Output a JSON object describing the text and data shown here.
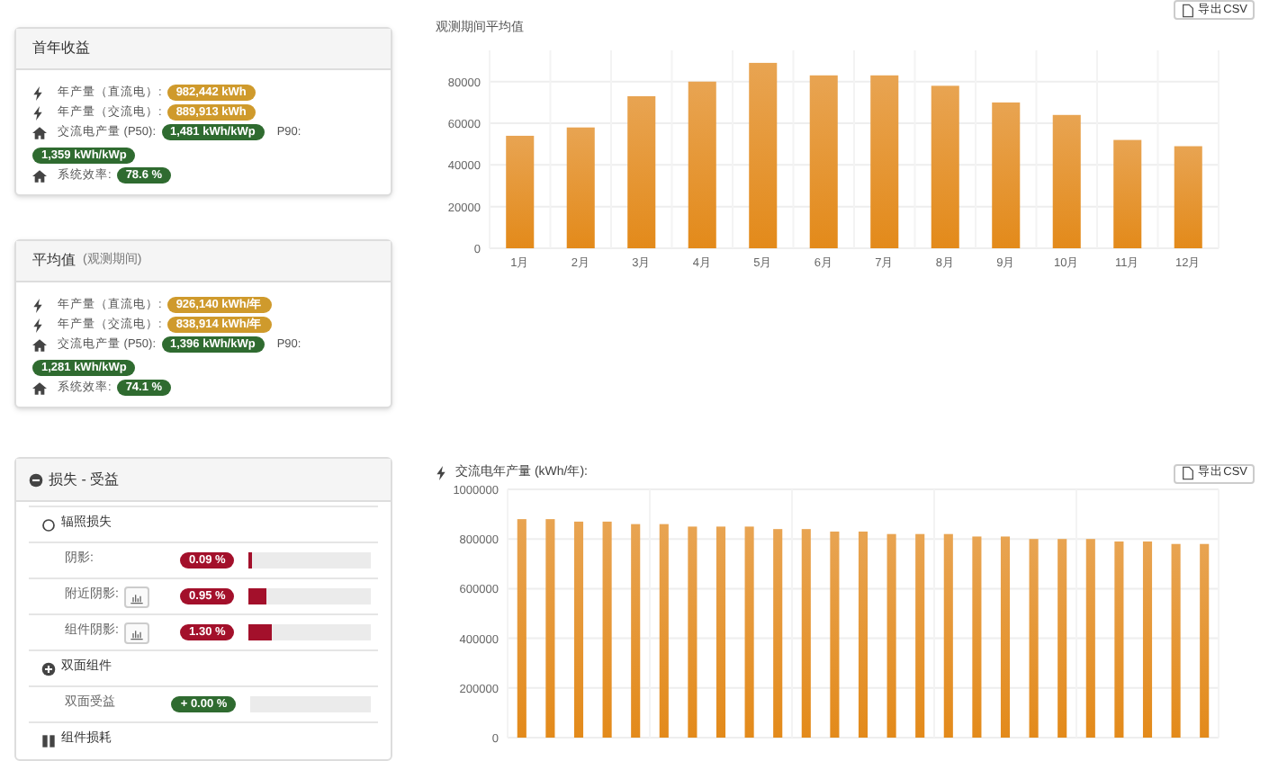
{
  "cards": [
    {
      "title": "首年收益",
      "items": [
        {
          "kind": "dc",
          "label": "年产量（直流电）:",
          "value": "982,442 kWh",
          "color": "#cf9a2c"
        },
        {
          "kind": "ac",
          "label": "年产量（交流电）:",
          "value": "889,913 kWh",
          "color": "#cf9a2c"
        },
        {
          "kind": "yield",
          "label": "交流电产量 (P50):",
          "value": "1,481 kWh/kWp",
          "color": "#2f6b30",
          "extra_label": "P90:",
          "extra_value": "1,359 kWh/kWp"
        },
        {
          "kind": "efficiency",
          "label": "系统效率:",
          "value": "78.6 %",
          "color": "#2f6b30"
        }
      ]
    },
    {
      "title": "平均值",
      "subtitle": "(观测期间)",
      "items": [
        {
          "kind": "dc",
          "label": "年产量（直流电）:",
          "value": "926,140 kWh/年",
          "color": "#cf9a2c"
        },
        {
          "kind": "ac",
          "label": "年产量（交流电）:",
          "value": "838,914 kWh/年",
          "color": "#cf9a2c"
        },
        {
          "kind": "yield",
          "label": "交流电产量 (P50):",
          "value": "1,396 kWh/kWp",
          "color": "#2f6b30",
          "extra_label": "P90:",
          "extra_value": "1,281 kWh/kWp"
        },
        {
          "kind": "efficiency",
          "label": "系统效率:",
          "value": "74.1 %",
          "color": "#2f6b30"
        }
      ]
    }
  ],
  "losses": {
    "title": "损失 - 受益",
    "rows": [
      {
        "kind": "irradiance",
        "label": "辐照损失"
      },
      {
        "kind": "bar",
        "label": "阴影:",
        "value": "0.09 %",
        "level": 0.01,
        "color": "#a3102b",
        "chart_button": false
      },
      {
        "kind": "bar",
        "label": "附近阴影:",
        "value": "0.95 %",
        "level": 0.14,
        "color": "#a3102b",
        "chart_button": true
      },
      {
        "kind": "bar",
        "label": "组件阴影:",
        "value": "1.30 %",
        "level": 0.19,
        "color": "#a3102b",
        "chart_button": true
      },
      {
        "kind": "bifacial",
        "label": "双面组件"
      },
      {
        "kind": "bar",
        "label": "双面受益",
        "value": "+ 0.00 %",
        "color": "#2f6b30",
        "chart_button": false
      },
      {
        "kind": "module",
        "label": "组件损耗"
      }
    ]
  },
  "monthly": {
    "export_button": "导出CSV",
    "subtitle": "观测期间平均值",
    "chart_data": {
      "type": "bar",
      "categories": [
        "1月",
        "2月",
        "3月",
        "4月",
        "5月",
        "6月",
        "7月",
        "8月",
        "9月",
        "10月",
        "11月",
        "12月"
      ],
      "series": [
        {
          "color": "#e38a1a",
          "values": [
            54000,
            58000,
            73000,
            80000,
            89000,
            83000,
            83000,
            78000,
            70000,
            64000,
            52000,
            49000
          ]
        }
      ],
      "ylim": [
        0,
        95000
      ],
      "yticks": [
        0,
        20000,
        40000,
        60000,
        80000
      ],
      "grid": true
    }
  },
  "yearly": {
    "title": "交流电年产量 (kWh/年):",
    "export_button": "导出CSV",
    "chart_data": {
      "type": "bar",
      "series": [
        {
          "color": "#e38a1a",
          "values": [
            880000,
            880000,
            870000,
            870000,
            860000,
            860000,
            850000,
            850000,
            850000,
            840000,
            840000,
            830000,
            830000,
            820000,
            820000,
            820000,
            810000,
            810000,
            800000,
            800000,
            800000,
            790000,
            790000,
            780000,
            780000
          ]
        }
      ],
      "ylim": [
        0,
        1000000
      ],
      "yticks": [
        0,
        200000,
        400000,
        600000,
        800000,
        1000000
      ],
      "grid": true
    }
  }
}
